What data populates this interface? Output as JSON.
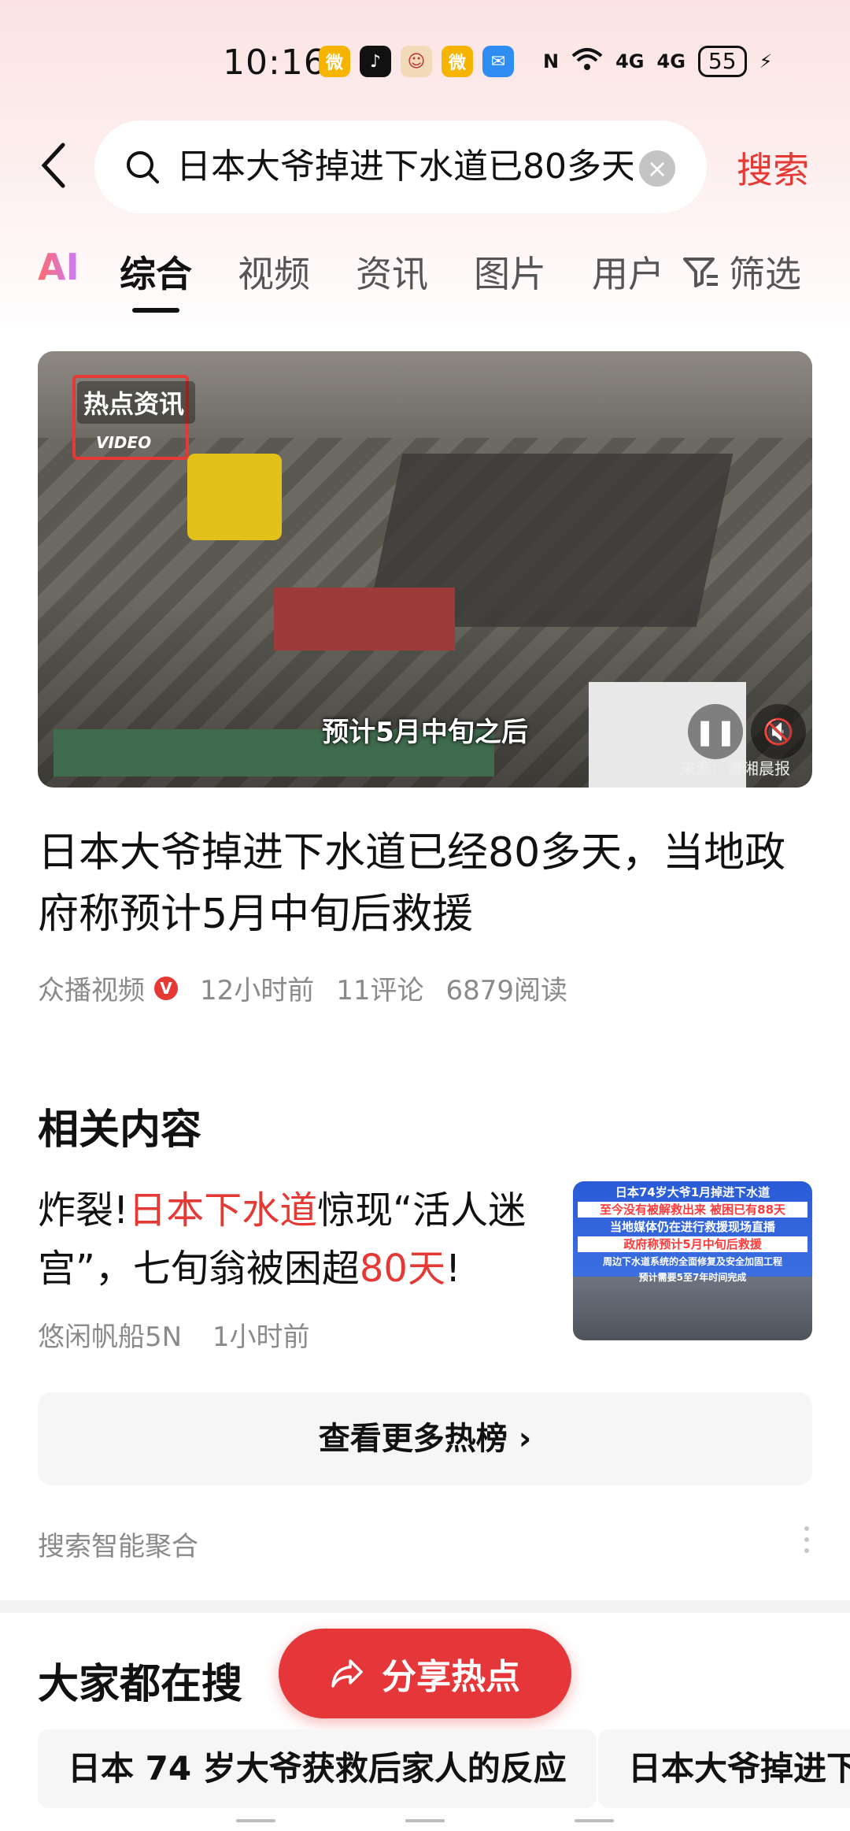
{
  "status_bar": {
    "time": "10:16",
    "battery": "55",
    "net1": "4G",
    "net2": "4G"
  },
  "search": {
    "query": "日本大爷掉进下水道已80多天",
    "submit_label": "搜索"
  },
  "tabs": {
    "ai": "AI",
    "items": [
      "综合",
      "视频",
      "资讯",
      "图片",
      "用户"
    ],
    "active": "综合",
    "filter_label": "筛选"
  },
  "video": {
    "tag": "热点资讯",
    "brand_label": "VIDEO",
    "subtitle": "预计5月中旬之后",
    "source": "来源：潇湘晨报"
  },
  "article": {
    "title": "日本大爷掉进下水道已经80多天，当地政府称预计5月中旬后救援",
    "author": "众播视频",
    "verified": "V",
    "time": "12小时前",
    "comments": "11评论",
    "reads": "6879阅读"
  },
  "related": {
    "heading": "相关内容",
    "item": {
      "text_part1": "炸裂!",
      "text_highlight1": "日本下水道",
      "text_part2": "惊现“活人迷宫”，七旬翁被困超",
      "text_highlight2": "80天",
      "text_part3": "!",
      "author": "悠闲帆船5N",
      "time": "1小时前",
      "thumb_lines": [
        "日本74岁大爷1月掉进下水道",
        "至今没有被解救出来 被困已有88天",
        "当地媒体仍在进行救援现场直播",
        "政府称预计5月中旬后救援",
        "周边下水道系统的全面修复及安全加固工程",
        "预计需要5至7年时间完成"
      ]
    },
    "more_label": "查看更多热榜",
    "more_arrow": "›"
  },
  "aggregate_label": "搜索智能聚合",
  "everyone": {
    "heading": "大家都在搜",
    "share_label": "分享热点",
    "chips": [
      "日本 74 岁大爷获救后家人的反应",
      "日本大爷掉进下"
    ]
  },
  "colors": {
    "accent": "#e53935",
    "top_gradient": "#fbe3e3"
  }
}
